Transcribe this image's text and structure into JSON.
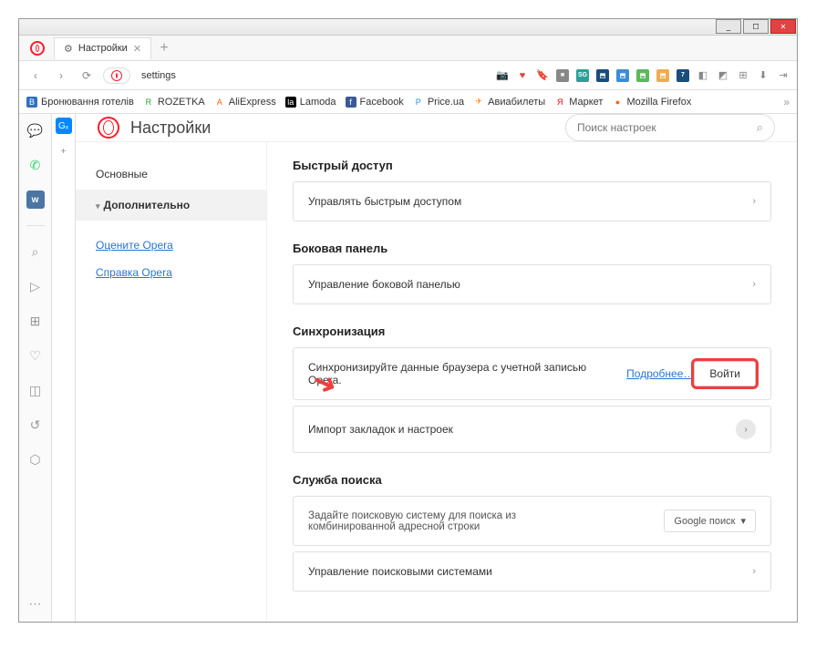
{
  "window": {
    "min": "_",
    "max": "☐",
    "close": "✕"
  },
  "tab": {
    "title": "Настройки",
    "close": "✕",
    "new": "+"
  },
  "urlbar": {
    "back": "‹",
    "forward": "›",
    "reload": "⟳",
    "opera_label": "O",
    "url": "settings"
  },
  "bookmarks": {
    "items": [
      {
        "icon": "В",
        "label": "Бронювання готелів"
      },
      {
        "icon": "R",
        "label": "ROZETKA"
      },
      {
        "icon": "A",
        "label": "AliExpress"
      },
      {
        "icon": "la",
        "label": "Lamoda"
      },
      {
        "icon": "f",
        "label": "Facebook"
      },
      {
        "icon": "P",
        "label": "Price.ua"
      },
      {
        "icon": "✈",
        "label": "Авиабилеты"
      },
      {
        "icon": "Я",
        "label": "Маркет"
      },
      {
        "icon": "🦊",
        "label": "Mozilla Firefox"
      }
    ],
    "more": "»"
  },
  "sidebar": {
    "messenger": "💬",
    "whatsapp": "✆",
    "vk": "w",
    "search": "⌕",
    "send": "▷",
    "grid": "⊞",
    "heart": "♡",
    "clip": "◫",
    "history": "↺",
    "cube": "⬡",
    "more": "⋯"
  },
  "tabsidebar": {
    "icon1": "Gₓ",
    "plus": "+"
  },
  "page": {
    "title": "Настройки",
    "search_placeholder": "Поиск настроек",
    "search_icon": "⌕"
  },
  "nav": {
    "basic": "Основные",
    "advanced": "Дополнительно",
    "rate": "Оцените Opera",
    "help": "Справка Opera"
  },
  "sections": {
    "quick": {
      "title": "Быстрый доступ",
      "row1": "Управлять быстрым доступом"
    },
    "sidepanel": {
      "title": "Боковая панель",
      "row1": "Управление боковой панелью"
    },
    "sync": {
      "title": "Синхронизация",
      "row1_text": "Синхронизируйте данные браузера с учетной записью Opera.",
      "row1_more": "Подробнее…",
      "row1_login": "Войти",
      "row2": "Импорт закладок и настроек"
    },
    "search": {
      "title": "Служба поиска",
      "row1": "Задайте поисковую систему для поиска из комбинированной адресной строки",
      "row1_dropdown": "Google поиск",
      "row2": "Управление поисковыми системами"
    }
  },
  "chevron": "›",
  "chevron_down": "▾",
  "arrow": "➜"
}
